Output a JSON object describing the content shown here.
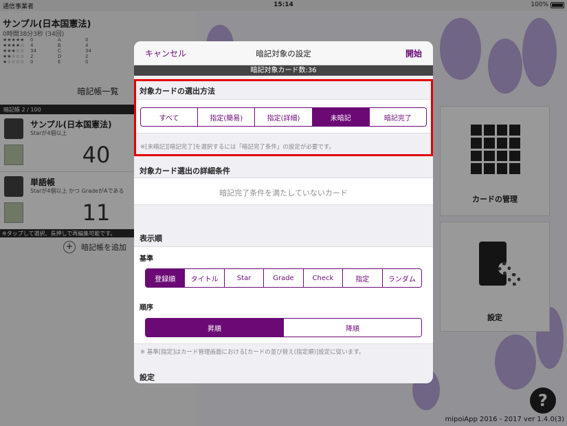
{
  "status_bar": {
    "carrier": "通信事業者",
    "time": "15:14",
    "battery": "100%"
  },
  "left_panel": {
    "book_title": "サンプル(日本国憲法)",
    "study_time": "0時間38分3秒 (34回)",
    "star_rows": [
      {
        "stars": "★★★★★",
        "count": "0",
        "grade": "A",
        "gcount": "0"
      },
      {
        "stars": "★★★★☆",
        "count": "4",
        "grade": "B",
        "gcount": "4"
      },
      {
        "stars": "★★★☆☆",
        "count": "34",
        "grade": "C",
        "gcount": "34"
      },
      {
        "stars": "★★☆☆☆",
        "count": "2",
        "grade": "D",
        "gcount": "2"
      },
      {
        "stars": "★☆☆☆☆",
        "count": "0",
        "grade": "E",
        "gcount": "0"
      }
    ],
    "list_title": "暗記帳一覧",
    "book_count": "暗記帳 2 / 100",
    "books": [
      {
        "name": "サンプル(日本国憲法)",
        "condition": "Starが4個以上",
        "count": "40"
      },
      {
        "name": "単語帳",
        "condition": "Starが4個以上 かつ GradeがAである",
        "count": "11"
      }
    ],
    "hint": "※タップして選択、長押しで再編集可能です。",
    "add_book": "暗記帳を追加"
  },
  "tiles": {
    "card_manage": "カードの管理",
    "settings": "設定"
  },
  "copyright": "mipoiApp 2016 - 2017 ver 1.4.0(3)",
  "help_label": "?",
  "modal": {
    "cancel": "キャンセル",
    "title": "暗記対象の設定",
    "start": "開始",
    "card_count": "暗記対象カード数:36",
    "selection_header": "対象カードの選出方法",
    "selection_options": [
      "すべて",
      "指定(簡易)",
      "指定(詳細)",
      "未暗記",
      "暗記完了"
    ],
    "selection_selected": "未暗記",
    "selection_note": "※[未暗記][暗記完了]を選択するには「暗記完了条件」の設定が必要です。",
    "detail_header": "対象カード選出の詳細条件",
    "detail_text": "暗記完了条件を満たしていないカード",
    "order_header": "表示順",
    "basis_label": "基準",
    "basis_options": [
      "登録順",
      "タイトル",
      "Star",
      "Grade",
      "Check",
      "指定",
      "ランダム"
    ],
    "basis_selected": "登録順",
    "order_label": "順序",
    "order_options": [
      "昇順",
      "降順"
    ],
    "order_selected": "昇順",
    "order_note": "※ 基準[指定]はカード管理画面における[カードの並び替え(指定順)]設定に従います。",
    "settings_header": "設定"
  },
  "colors": {
    "accent": "#6b0a75",
    "highlight": "#e10000"
  }
}
